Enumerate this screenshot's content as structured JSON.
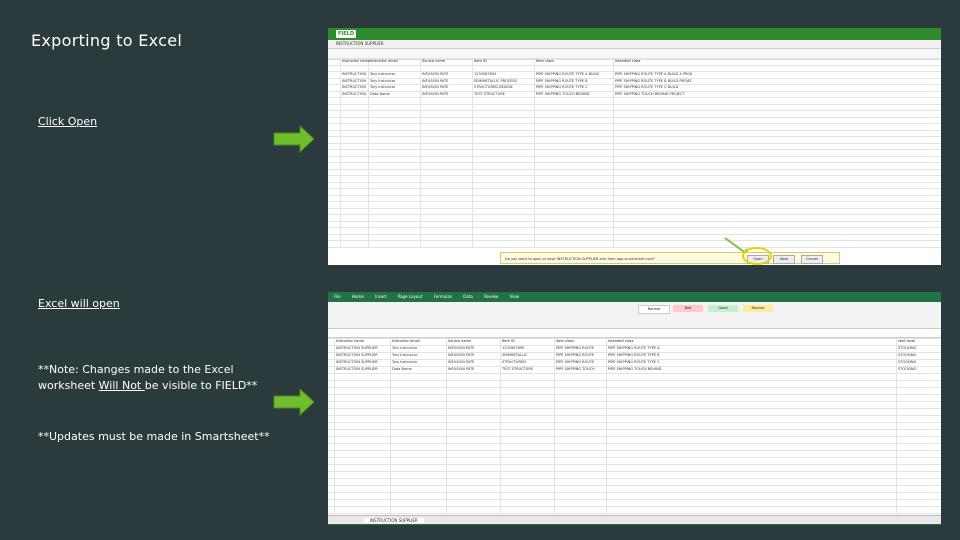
{
  "title": "Exporting to Excel",
  "notes": {
    "click_open": "Click Open",
    "excel_will_open": "Excel will open",
    "note1_prefix": "**Note: Changes made to the Excel worksheet ",
    "note1_underline": "Will Not ",
    "note1_suffix": "be visible to FIELD**",
    "note2": "**Updates must be made in Smartsheet**"
  },
  "colors": {
    "background": "#2b3a3d",
    "arrow": "#6fbe2e",
    "smartsheet_bar": "#2e8b2e",
    "excel_ribbon": "#217346",
    "highlight": "#e4d200"
  },
  "smartsheet": {
    "logo": "FIELD",
    "sheet_name": "INSTRUCTION SUPPLIER",
    "columns": [
      "Instructor name",
      "Instructor email",
      "Source name",
      "Item ID",
      "Item class",
      "Intended class"
    ],
    "rows": [
      [
        "INSTRUCTION SUPPLIER",
        "Tory Instructor",
        "INFUSION PATE",
        "1234567890",
        "PIPE SHIPPING ROUTE TYPE A BUILD",
        "PIPE SHIPPING ROUTE TYPE A BUILD A PROJECT TO"
      ],
      [
        "INSTRUCTION SUPPLIER",
        "Tory Instructor",
        "INFUSION PATE",
        "SEMIMETALLIC PROCESS",
        "PIPE SHIPPING ROUTE TYPE B",
        "PIPE SHIPPING ROUTE TYPE B BUILD PROJECT"
      ],
      [
        "INSTRUCTION SUPPLIER",
        "Tory Instructor",
        "INFUSION PATE",
        "STRUCTURED DESIGN",
        "PIPE SHIPPING ROUTE TYPE C",
        "PIPE SHIPPING ROUTE TYPE C BUILD"
      ],
      [
        "INSTRUCTION SUPPLIER",
        "Data Name",
        "INFUSION PATE",
        "TEST STRUCTURE",
        "PIPE SHIPPING TOUCH BEHIND",
        "PIPE SHIPPING TOUCH BEHIND PROJECT"
      ]
    ],
    "download_banner": "Do you want to open or save INSTRUCTION SUPPLIER.xlsx from app.smartsheet.com?",
    "buttons": [
      "Open",
      "Save",
      "Cancel"
    ]
  },
  "excel": {
    "tabs": [
      "File",
      "Home",
      "Insert",
      "Page Layout",
      "Formulas",
      "Data",
      "Review",
      "View"
    ],
    "styles": [
      "Normal",
      "Bad",
      "Good",
      "Neutral"
    ],
    "sheet_tab": "INSTRUCTION SUPPLIER",
    "columns": [
      "Instructor name",
      "Instructor email",
      "Source name",
      "Item ID",
      "Item class",
      "Intended class",
      "sent level"
    ],
    "rows": [
      [
        "INSTRUCTION SUPPLIER",
        "Tory Instructor",
        "INFUSION PATE",
        "1234567890",
        "PIPE SHIPPING ROUTE",
        "PIPE SHIPPING ROUTE TYPE A",
        "STOCKING"
      ],
      [
        "INSTRUCTION SUPPLIER",
        "Tory Instructor",
        "INFUSION PATE",
        "SEMIMETALLIC",
        "PIPE SHIPPING ROUTE",
        "PIPE SHIPPING ROUTE TYPE B",
        "STOCKING"
      ],
      [
        "INSTRUCTION SUPPLIER",
        "Tory Instructor",
        "INFUSION PATE",
        "STRUCTURED",
        "PIPE SHIPPING ROUTE",
        "PIPE SHIPPING ROUTE TYPE C",
        "STOCKING"
      ],
      [
        "INSTRUCTION SUPPLIER",
        "Data Name",
        "INFUSION PATE",
        "TEST STRUCTURE",
        "PIPE SHIPPING TOUCH",
        "PIPE SHIPPING TOUCH BEHIND",
        "STOCKING"
      ]
    ]
  }
}
